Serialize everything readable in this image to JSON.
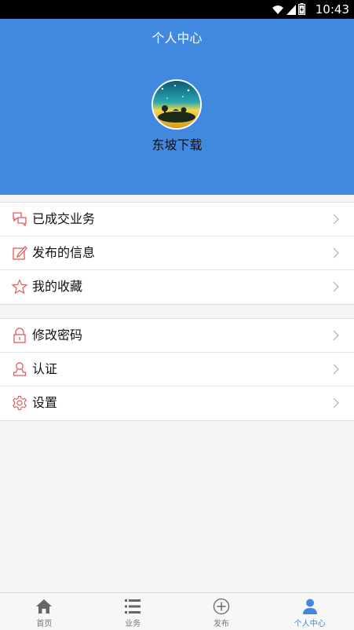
{
  "status_bar": {
    "time": "10:43"
  },
  "header": {
    "title": "个人中心",
    "username": "东坡下载"
  },
  "menu_group_1": [
    {
      "label": "已成交业务",
      "icon": "chat-bubbles-icon"
    },
    {
      "label": "发布的信息",
      "icon": "edit-icon"
    },
    {
      "label": "我的收藏",
      "icon": "star-icon"
    }
  ],
  "menu_group_2": [
    {
      "label": "修改密码",
      "icon": "lock-icon"
    },
    {
      "label": "认证",
      "icon": "user-icon"
    },
    {
      "label": "设置",
      "icon": "gear-icon"
    }
  ],
  "tabbar": [
    {
      "label": "首页",
      "icon": "home-icon"
    },
    {
      "label": "业务",
      "icon": "list-icon"
    },
    {
      "label": "发布",
      "icon": "plus-circle-icon"
    },
    {
      "label": "个人中心",
      "icon": "person-icon"
    }
  ],
  "colors": {
    "primary": "#4189df",
    "icon_accent": "#e05a5a"
  }
}
